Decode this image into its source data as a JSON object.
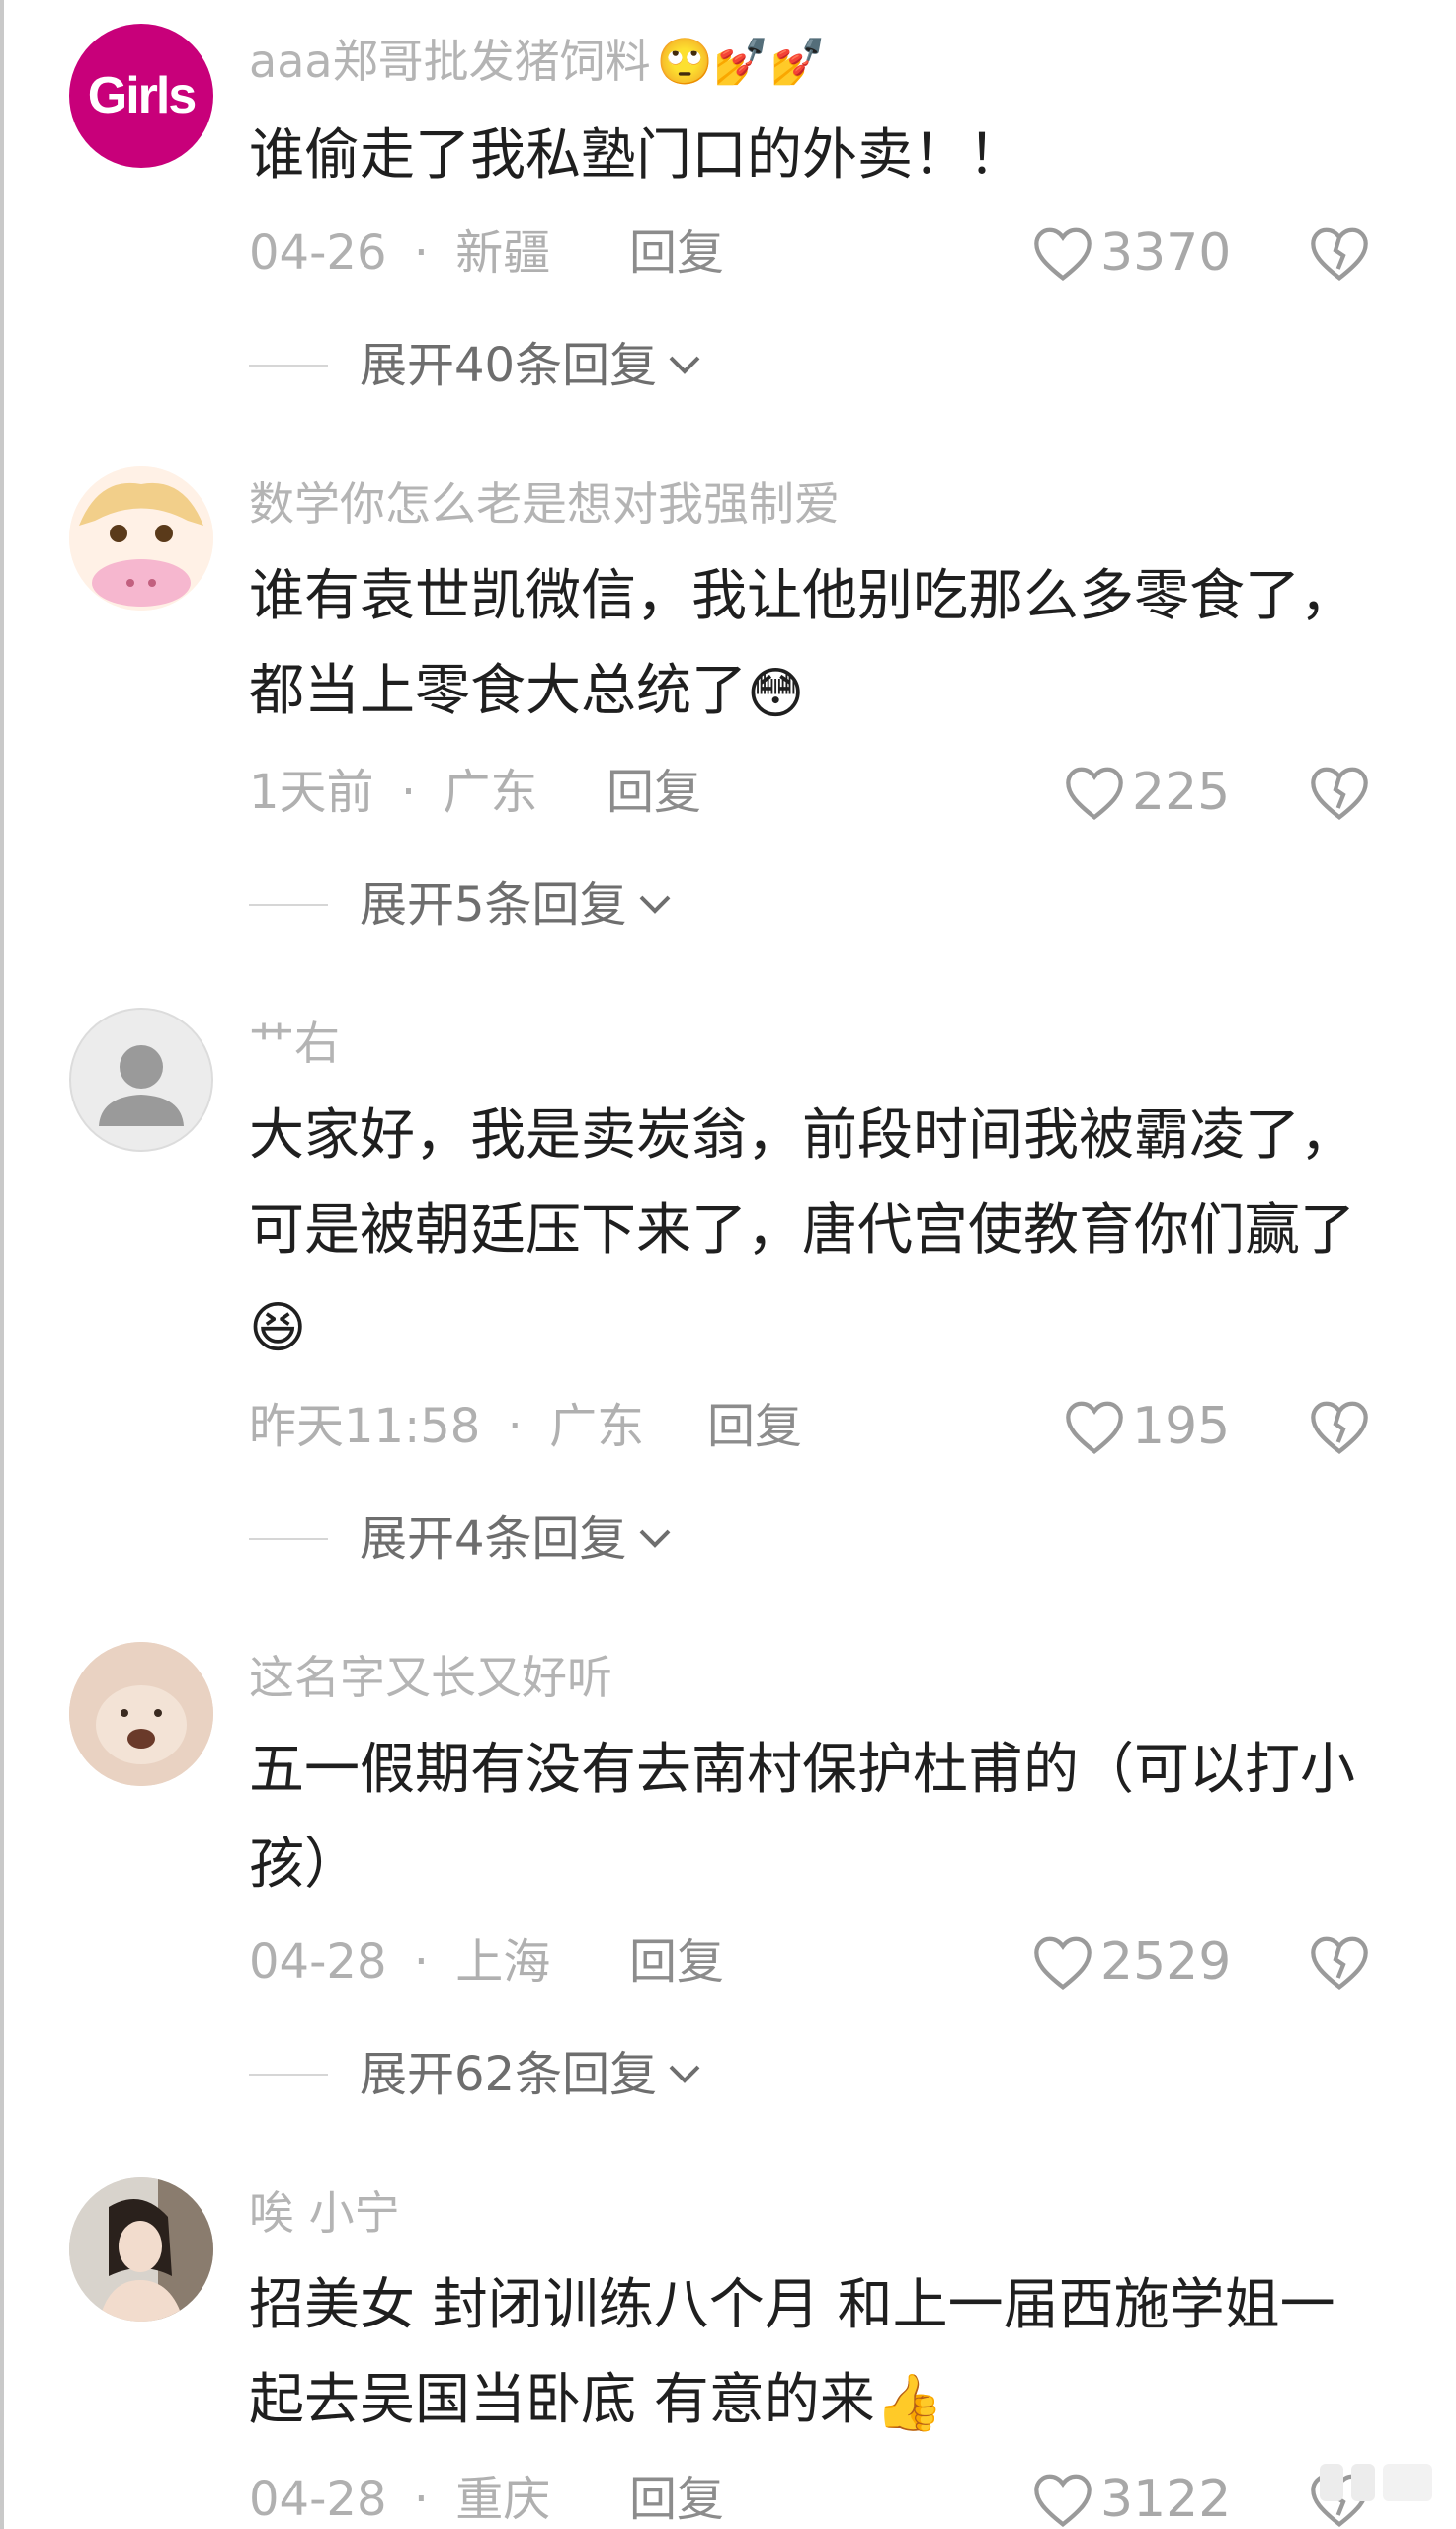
{
  "comments": [
    {
      "username": "aaa郑哥批发猪饲料",
      "text": "谁偷走了我私塾门口的外卖！！",
      "time": "04-26",
      "location": "新疆",
      "reply_label": "回复",
      "likes": "3370",
      "expand": "展开40条回复",
      "avatar_text": "Girls"
    },
    {
      "username": "数学你怎么老是想对我强制爱",
      "text": "谁有袁世凯微信，我让他别吃那么多零食了，都当上零食大总统了",
      "time": "1天前",
      "location": "广东",
      "reply_label": "回复",
      "likes": "225",
      "expand": "展开5条回复"
    },
    {
      "username": "艹右",
      "text": "大家好，我是卖炭翁，前段时间我被霸凌了，可是被朝廷压下来了，唐代宫使教育你们赢了",
      "time": "昨天11:58",
      "location": "广东",
      "reply_label": "回复",
      "likes": "195",
      "expand": "展开4条回复"
    },
    {
      "username": "这名字又长又好听",
      "text": "五一假期有没有去南村保护杜甫的（可以打小孩）",
      "time": "04-28",
      "location": "上海",
      "reply_label": "回复",
      "likes": "2529",
      "expand": "展开62条回复"
    },
    {
      "username": "唉 小宁",
      "text": "招美女 封闭训练八个月 和上一届西施学姐一起去吴国当卧底 有意的来",
      "time": "04-28",
      "location": "重庆",
      "reply_label": "回复",
      "likes": "3122"
    }
  ],
  "separator": "·",
  "colors": {
    "username": "#b4b4b4",
    "text": "#1f1f1f",
    "meta": "#b0b0b0",
    "avatar_brand": "#c8007a"
  },
  "icons": [
    "heart-icon",
    "heart-broken-icon",
    "chevron-down-icon",
    "emoji-icon",
    "thumbs-up-icon"
  ]
}
